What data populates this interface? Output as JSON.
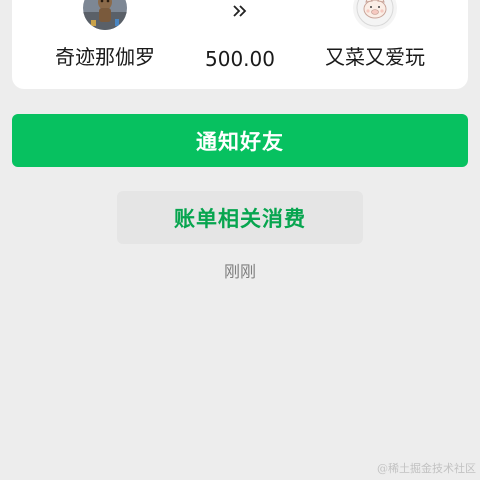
{
  "transfer": {
    "from_name": "奇迹那伽罗",
    "amount": "500.00",
    "to_name": "又菜又爱玩",
    "direction_icon": "double-chevron-right-icon"
  },
  "actions": {
    "notify_label": "通知好友",
    "related_label": "账单相关消费"
  },
  "status": {
    "time": "刚刚"
  },
  "watermark": "@稀土掘金技术社区",
  "colors": {
    "primary_green": "#07c160",
    "page_bg": "#ededed"
  }
}
